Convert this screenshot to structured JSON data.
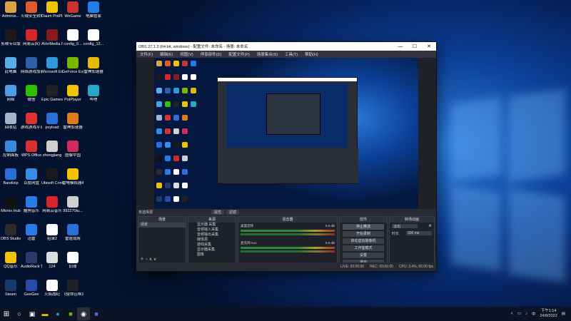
{
  "desktop": {
    "icons": [
      {
        "label": "Adminis...",
        "color": "#d9a441",
        "col": 0,
        "row": 0
      },
      {
        "label": "火绒安全软件",
        "color": "#e05a2a",
        "col": 1,
        "row": 0
      },
      {
        "label": "Daum PotPlayer",
        "color": "#f2c400",
        "col": 2,
        "row": 0
      },
      {
        "label": "WeGame",
        "color": "#c9342f",
        "col": 3,
        "row": 0
      },
      {
        "label": "电脑管家",
        "color": "#1f7ee8",
        "col": 4,
        "row": 0
      },
      {
        "label": "剪映专业版",
        "color": "#1a1a1a",
        "col": 0,
        "row": 1
      },
      {
        "label": "网易云(K)",
        "color": "#d8252a",
        "col": 1,
        "row": 1
      },
      {
        "label": "AVerMedia RECentral",
        "color": "#8a1b1b",
        "col": 2,
        "row": 1
      },
      {
        "label": "config_0...",
        "color": "#ffffff",
        "col": 3,
        "row": 1
      },
      {
        "label": "config_12...",
        "color": "#ffffff",
        "col": 4,
        "row": 1
      },
      {
        "label": "此电脑",
        "color": "#5aaee8",
        "col": 0,
        "row": 2
      },
      {
        "label": "网络游戏加速器",
        "color": "#2c5fa8",
        "col": 1,
        "row": 2
      },
      {
        "label": "Microsoft Edge",
        "color": "#2d9bd8",
        "col": 2,
        "row": 2
      },
      {
        "label": "GeForce Experience",
        "color": "#76b900",
        "col": 3,
        "row": 2
      },
      {
        "label": "雷神加速器",
        "color": "#e6b800",
        "col": 4,
        "row": 2
      },
      {
        "label": "网络",
        "color": "#4aa0e8",
        "col": 0,
        "row": 3
      },
      {
        "label": "微信",
        "color": "#2dc100",
        "col": 1,
        "row": 3
      },
      {
        "label": "Epic Games Launcher",
        "color": "#222222",
        "col": 2,
        "row": 3
      },
      {
        "label": "PotPlayer",
        "color": "#f2c400",
        "col": 3,
        "row": 3
      },
      {
        "label": "哔哩",
        "color": "#2aa7c8",
        "col": 4,
        "row": 3
      },
      {
        "label": "回收站",
        "color": "#9fb5c8",
        "col": 0,
        "row": 4
      },
      {
        "label": "游戏游戏平台",
        "color": "#e03030",
        "col": 1,
        "row": 4
      },
      {
        "label": "pvyload",
        "color": "#2a6fd8",
        "col": 2,
        "row": 4
      },
      {
        "label": "雷神加速器",
        "color": "#e07a1a",
        "col": 3,
        "row": 4
      },
      {
        "label": "控制面板",
        "color": "#3a8ad8",
        "col": 0,
        "row": 5
      },
      {
        "label": "WPS Office",
        "color": "#d83030",
        "col": 1,
        "row": 5
      },
      {
        "label": "zhongjiang",
        "color": "#cfcfcf",
        "col": 2,
        "row": 5
      },
      {
        "label": "图像中国",
        "color": "#d02a5a",
        "col": 3,
        "row": 5
      },
      {
        "label": "Bandizip",
        "color": "#2a6fd8",
        "col": 0,
        "row": 6
      },
      {
        "label": "百度网盘",
        "color": "#3a8ae8",
        "col": 1,
        "row": 6
      },
      {
        "label": "Ubisoft Connect",
        "color": "#1a1a1a",
        "col": 2,
        "row": 6
      },
      {
        "label": "雷电模拟器4",
        "color": "#f2c400",
        "col": 3,
        "row": 6
      },
      {
        "label": "Mionix Hub",
        "color": "#111111",
        "col": 0,
        "row": 7
      },
      {
        "label": "酷狗音乐",
        "color": "#2a7ae8",
        "col": 1,
        "row": 7
      },
      {
        "label": "网易云音乐",
        "color": "#d8252a",
        "col": 2,
        "row": 7
      },
      {
        "label": "992270tu...",
        "color": "#cfcfcf",
        "col": 3,
        "row": 7
      },
      {
        "label": "OBS Studio",
        "color": "#2b2b2b",
        "col": 0,
        "row": 8
      },
      {
        "label": "迅雷",
        "color": "#2a7ae8",
        "col": 1,
        "row": 8
      },
      {
        "label": "招录2",
        "color": "#ffffff",
        "col": 2,
        "row": 8
      },
      {
        "label": "雷霆战将",
        "color": "#2a6fd8",
        "col": 3,
        "row": 8
      },
      {
        "label": "QQ音乐",
        "color": "#f2c400",
        "col": 0,
        "row": 9
      },
      {
        "label": "AudioRack 快捷方式(2)",
        "color": "#2a3a6a",
        "col": 1,
        "row": 9
      },
      {
        "label": "124",
        "color": "#dddddd",
        "col": 2,
        "row": 9
      },
      {
        "label": "旧球",
        "color": "#ffffff",
        "col": 3,
        "row": 9
      },
      {
        "label": "Steam",
        "color": "#1b3a6a",
        "col": 0,
        "row": 10
      },
      {
        "label": "GeeGee",
        "color": "#2a4aa8",
        "col": 1,
        "row": 10
      },
      {
        "label": "火焰战纪",
        "color": "#ffffff",
        "col": 2,
        "row": 10
      },
      {
        "label": "《使命召唤》战区快捷方式",
        "color": "#222222",
        "col": 3,
        "row": 10
      }
    ]
  },
  "obs": {
    "title": "OBS 27.1.3 (64-bit, windows) - 配置文件: 未命名 - 场景: 未命名",
    "window_buttons": {
      "minimize": "—",
      "maximize": "☐",
      "close": "✕"
    },
    "menu": [
      "文件(F)",
      "编辑(E)",
      "视图(V)",
      "停靠部件(D)",
      "配置文件(P)",
      "场景集合(S)",
      "工具(T)",
      "帮助(H)"
    ],
    "scene_bar": {
      "label": "未选择源",
      "tab_properties": "属性",
      "tab_filters": "滤镜"
    },
    "panels": {
      "scenes": {
        "header": "场景",
        "items": [
          "场景"
        ]
      },
      "sources": {
        "header": "来源",
        "items": [
          "显示器 采集",
          "音频输入采集",
          "音频输出采集",
          "媒体源",
          "游戏采集",
          "显示器采集",
          "图像"
        ]
      },
      "mixer": {
        "header": "混音器",
        "tracks": [
          {
            "name": "桌面音频",
            "db": "0.0 dB"
          },
          {
            "name": "麦克风/Aux",
            "db": "0.0 dB"
          }
        ]
      },
      "controls": {
        "header": "控件",
        "buttons": [
          "停止推流",
          "开始录制",
          "启动虚拟摄像机",
          "工作室模式",
          "设置",
          "退出"
        ]
      },
      "transitions": {
        "header": "转场动画",
        "type": "淡出",
        "duration_label": "时长",
        "duration_value": "300 ms"
      }
    },
    "status": {
      "live": "LIVE: 00:00:00",
      "rec": "REC: 00:00:00",
      "cpu": "CPU: 3.4%, 60.00 fps"
    }
  },
  "taskbar": {
    "time": "下午1:14",
    "date": "24/8/2022",
    "start_icon": "windows-start-icon",
    "pinned": [
      "search-icon",
      "task-view-icon",
      "file-explorer-icon",
      "edge-icon",
      "nvidia-icon",
      "obs-icon",
      "app-icon"
    ]
  }
}
